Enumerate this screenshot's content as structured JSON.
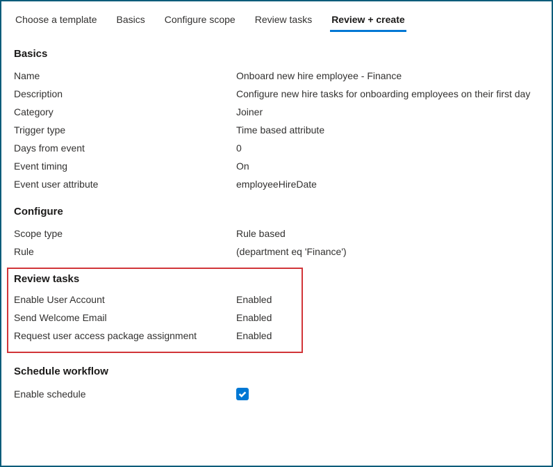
{
  "tabs": {
    "choose_template": "Choose a template",
    "basics": "Basics",
    "configure_scope": "Configure scope",
    "review_tasks": "Review tasks",
    "review_create": "Review + create"
  },
  "sections": {
    "basics": {
      "heading": "Basics",
      "rows": {
        "name": {
          "label": "Name",
          "value": "Onboard new hire employee - Finance"
        },
        "description": {
          "label": "Description",
          "value": "Configure new hire tasks for onboarding employees on their first day"
        },
        "category": {
          "label": "Category",
          "value": "Joiner"
        },
        "trigger_type": {
          "label": "Trigger type",
          "value": "Time based attribute"
        },
        "days_from_event": {
          "label": "Days from event",
          "value": "0"
        },
        "event_timing": {
          "label": "Event timing",
          "value": "On"
        },
        "event_user_attribute": {
          "label": "Event user attribute",
          "value": "employeeHireDate"
        }
      }
    },
    "configure": {
      "heading": "Configure",
      "rows": {
        "scope_type": {
          "label": "Scope type",
          "value": "Rule based"
        },
        "rule": {
          "label": "Rule",
          "value": " (department eq 'Finance')"
        }
      }
    },
    "review_tasks": {
      "heading": "Review tasks",
      "rows": {
        "enable_user_account": {
          "label": "Enable User Account",
          "value": "Enabled"
        },
        "send_welcome_email": {
          "label": "Send Welcome Email",
          "value": "Enabled"
        },
        "request_access_package": {
          "label": "Request user access package assignment",
          "value": "Enabled"
        }
      }
    },
    "schedule": {
      "heading": "Schedule workflow",
      "enable_schedule_label": "Enable schedule",
      "enable_schedule_checked": true
    }
  }
}
